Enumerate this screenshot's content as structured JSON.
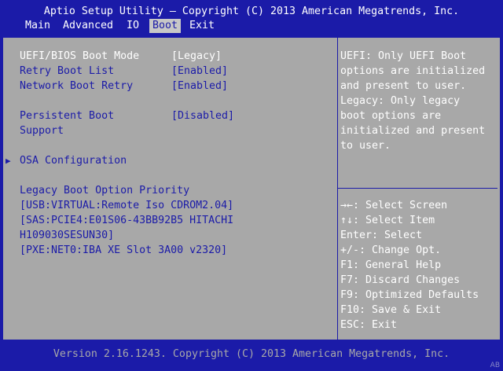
{
  "title": "Aptio Setup Utility – Copyright (C) 2013 American Megatrends, Inc.",
  "menu": [
    "Main",
    "Advanced",
    "IO",
    "Boot",
    "Exit"
  ],
  "active_menu": "Boot",
  "settings": {
    "uefi_bios_boot_mode": {
      "label": "UEFI/BIOS Boot Mode",
      "value": "[Legacy]"
    },
    "retry_boot_list": {
      "label": "Retry Boot List",
      "value": "[Enabled]"
    },
    "network_boot_retry": {
      "label": "Network Boot Retry",
      "value": "[Enabled]"
    },
    "persistent_boot_support": {
      "label_line1": "Persistent Boot",
      "label_line2": "Support",
      "value": "[Disabled]"
    },
    "osa_configuration": {
      "label": "OSA Configuration"
    }
  },
  "legacy_priority": {
    "heading": "Legacy Boot Option Priority",
    "items": [
      "[USB:VIRTUAL:Remote Iso CDROM2.04]",
      "[SAS:PCIE4:E01S06-43BB92B5 HITACHI",
      "H109030SESUN30]",
      "[PXE:NET0:IBA XE Slot 3A00 v2320]"
    ]
  },
  "help_text": [
    "UEFI: Only UEFI Boot",
    "options are initialized",
    "and present to user.",
    "Legacy: Only legacy",
    "boot options are",
    "initialized and present",
    "to user."
  ],
  "key_help": [
    "→←: Select Screen",
    "↑↓: Select Item",
    "Enter: Select",
    "+/-: Change Opt.",
    "F1: General Help",
    "F7: Discard Changes",
    "F9: Optimized Defaults",
    "F10: Save & Exit",
    "ESC: Exit"
  ],
  "footer": "Version 2.16.1243. Copyright (C) 2013 American Megatrends, Inc.",
  "corner_badge": "AB",
  "colors": {
    "background": "#1b1ba8",
    "panel": "#a8a8a8",
    "highlight_text": "#ffffff",
    "normal_text": "#1b1ba8"
  }
}
